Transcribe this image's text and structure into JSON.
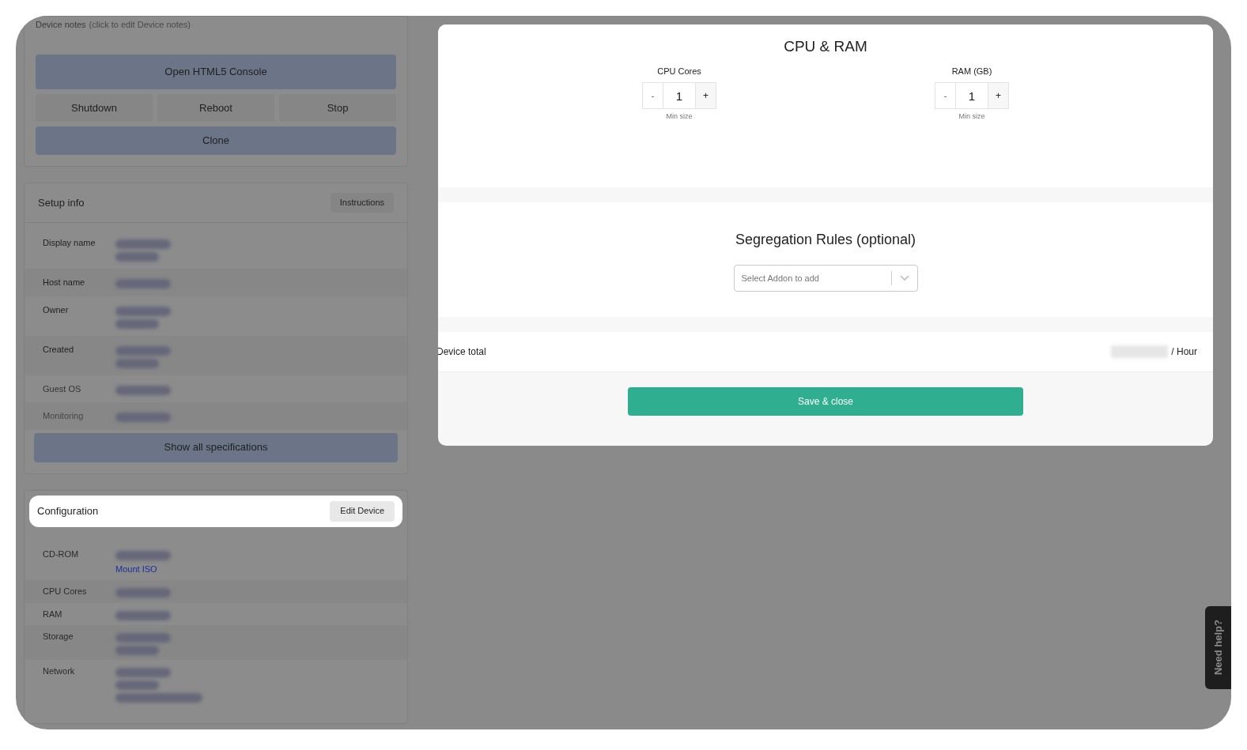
{
  "device_notes": {
    "label": "Device notes",
    "hint": "(click to edit Device notes)"
  },
  "actions": {
    "console": "Open HTML5 Console",
    "power": [
      "Shutdown",
      "Reboot",
      "Stop"
    ],
    "clone": "Clone"
  },
  "setup_info": {
    "title": "Setup info",
    "button": "Instructions",
    "rows": [
      {
        "label": "Display name",
        "kind": "normal"
      },
      {
        "label": "Host name",
        "kind": "normal"
      },
      {
        "label": "Owner",
        "kind": "normal"
      },
      {
        "label": "Created",
        "kind": "normal"
      },
      {
        "label": "Guest OS",
        "kind": "dim"
      },
      {
        "label": "Monitoring",
        "kind": "faded"
      }
    ],
    "show_all": "Show all specifications"
  },
  "configuration": {
    "title": "Configuration",
    "button": "Edit Device",
    "highlighted": true,
    "rows": [
      {
        "label": "CD-ROM",
        "link": "Mount ISO"
      },
      {
        "label": "CPU Cores"
      },
      {
        "label": "RAM"
      },
      {
        "label": "Storage"
      },
      {
        "label": "Network"
      }
    ]
  },
  "modal": {
    "cpu_ram": {
      "title": "CPU & RAM",
      "steppers": [
        {
          "label": "CPU Cores",
          "minus": "-",
          "value": "1",
          "plus": "+",
          "hint": "Min size"
        },
        {
          "label": "RAM (GB)",
          "minus": "-",
          "value": "1",
          "plus": "+",
          "hint": "Min size"
        }
      ]
    },
    "segregation": {
      "title": "Segregation Rules (optional)",
      "select": {
        "placeholder": "Select Addon to add"
      }
    },
    "total": {
      "label": "Device total",
      "unit": "/ Hour"
    },
    "save": "Save & close"
  },
  "help_tab": "Need help?"
}
